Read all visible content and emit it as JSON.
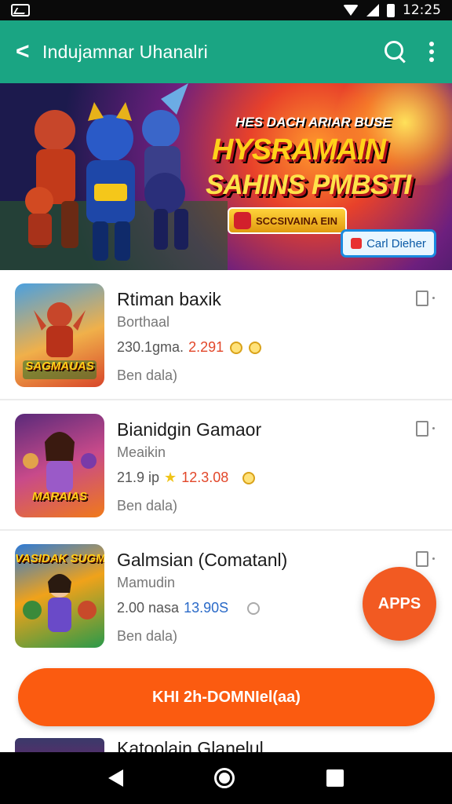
{
  "status_bar": {
    "time": "12:25",
    "icons": [
      "app-icon",
      "wifi-icon",
      "signal-icon",
      "battery-icon"
    ]
  },
  "app_bar": {
    "back_label": "<",
    "title": "Indujamnar Uhanalri",
    "icons": [
      "search-icon",
      "more-vert-icon"
    ],
    "color": "#1aa583"
  },
  "banner": {
    "kicker": "HES DACH ARIAR BUSE",
    "headline": "HYSRAMAIN",
    "headline2": "SAHINS PMBSTI",
    "pill_text": "SCCSIVAINA EIN",
    "cta_label": "Carl Dieher"
  },
  "apps": [
    {
      "name": "Rtiman baxik",
      "developer": "Borthaal",
      "meta_main": "230.1gma.",
      "meta_highlight": "2.291",
      "sub": "Ben dala)",
      "thumb_label": "SAGMAUAS",
      "colors": [
        "#4aa0e0",
        "#d8462a"
      ]
    },
    {
      "name": "Bianidgin Gamaor",
      "developer": "Meaikin",
      "meta_main": "21.9 ip",
      "meta_highlight": "12.3.08",
      "sub": "Ben dala)",
      "thumb_label": "MARAIAS",
      "colors": [
        "#5a2a7a",
        "#f07a1a"
      ]
    },
    {
      "name": "Galmsian (Comatanl)",
      "developer": "Mamudin",
      "meta_main": "2.00 nasa",
      "meta_highlight": "13.90S",
      "sub": "Ben dala)",
      "thumb_label": "VASIDAK SUGMAAD",
      "colors": [
        "#2c7ad8",
        "#2a9a4a"
      ]
    }
  ],
  "fab": {
    "label": "APPS",
    "color": "#f25a22"
  },
  "cta": {
    "label": "KHI 2h-DOMNIel(aa)",
    "color": "#fb5b10"
  },
  "peek_item": {
    "name": "Katoolain Glanelul"
  },
  "nav_bar": {
    "icons": [
      "back-triangle-icon",
      "home-circle-icon",
      "recents-square-icon"
    ]
  }
}
